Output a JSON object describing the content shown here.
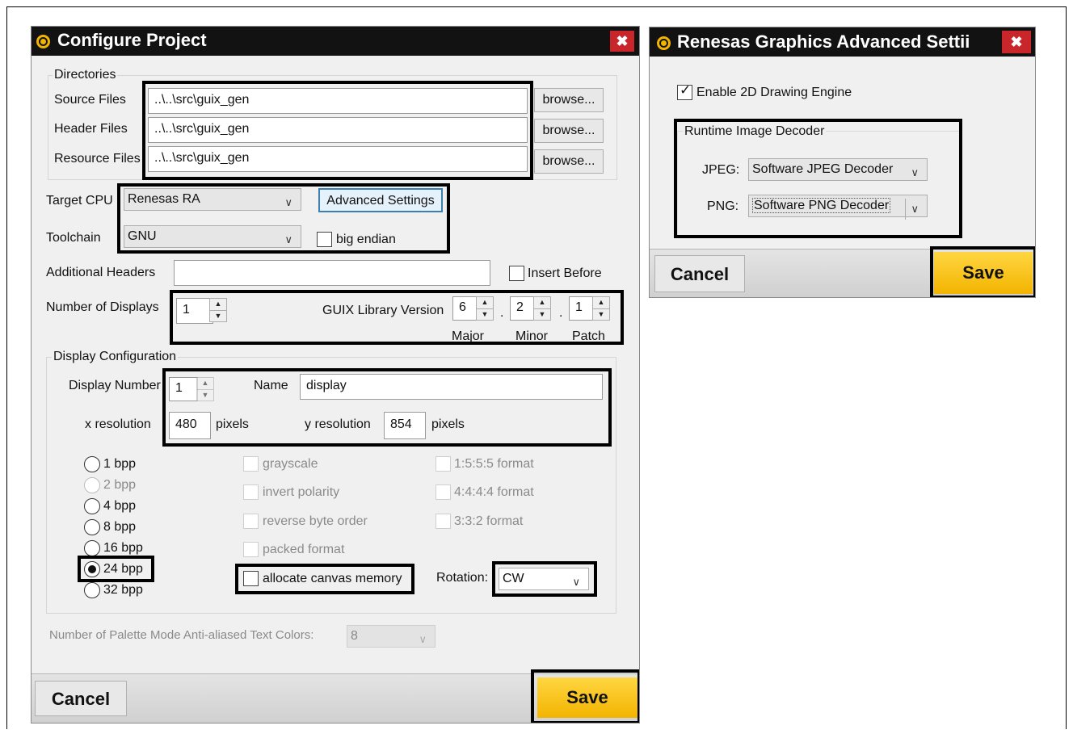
{
  "configure": {
    "title": "Configure Project",
    "close": "✖",
    "directories": {
      "group_label": "Directories",
      "source_label": "Source Files",
      "source_value": "..\\..\\src\\guix_gen",
      "header_label": "Header Files",
      "header_value": "..\\..\\src\\guix_gen",
      "resource_label": "Resource Files",
      "resource_value": "..\\..\\src\\guix_gen",
      "browse": "browse..."
    },
    "target_cpu_label": "Target CPU",
    "target_cpu_value": "Renesas RA",
    "advanced_settings": "Advanced Settings",
    "toolchain_label": "Toolchain",
    "toolchain_value": "GNU",
    "big_endian": "big endian",
    "additional_headers_label": "Additional Headers",
    "additional_headers_value": "",
    "insert_before": "Insert Before",
    "num_displays_label": "Number of Displays",
    "num_displays_value": "1",
    "guix_version_label": "GUIX Library Version",
    "version_major": "6",
    "version_minor": "2",
    "version_patch": "1",
    "dot": ".",
    "major_label": "Major",
    "minor_label": "Minor",
    "patch_label": "Patch",
    "display_config": {
      "group_label": "Display Configuration",
      "display_number_label": "Display Number",
      "display_number_value": "1",
      "name_label": "Name",
      "name_value": "display",
      "x_res_label": "x resolution",
      "x_res_value": "480",
      "y_res_label": "y resolution",
      "y_res_value": "854",
      "pixels": "pixels",
      "bpp_options": [
        "1 bpp",
        "2 bpp",
        "4 bpp",
        "8 bpp",
        "16 bpp",
        "24 bpp",
        "32 bpp"
      ],
      "selected_bpp": "24 bpp",
      "grayscale": "grayscale",
      "invert_polarity": "invert polarity",
      "reverse_byte_order": "reverse byte order",
      "packed_format": "packed format",
      "allocate_canvas_memory": "allocate canvas memory",
      "format_1555": "1:5:5:5 format",
      "format_4444": "4:4:4:4 format",
      "format_332": "3:3:2 format",
      "rotation_label": "Rotation:",
      "rotation_value": "CW"
    },
    "palette_label": "Number of Palette Mode Anti-aliased Text Colors:",
    "palette_value": "8",
    "cancel": "Cancel",
    "save": "Save"
  },
  "advanced": {
    "title": "Renesas Graphics Advanced Settii",
    "close": "✖",
    "enable_2d": "Enable 2D Drawing Engine",
    "decoder_group": "Runtime Image Decoder",
    "jpeg_label": "JPEG:",
    "jpeg_value": "Software JPEG Decoder",
    "png_label": "PNG:",
    "png_value": "Software PNG Decoder",
    "cancel": "Cancel",
    "save": "Save"
  },
  "colors": {
    "titlebar": "#121212",
    "save_button": "#f3b400",
    "close_button": "#c8262b",
    "highlight": "#000000"
  }
}
